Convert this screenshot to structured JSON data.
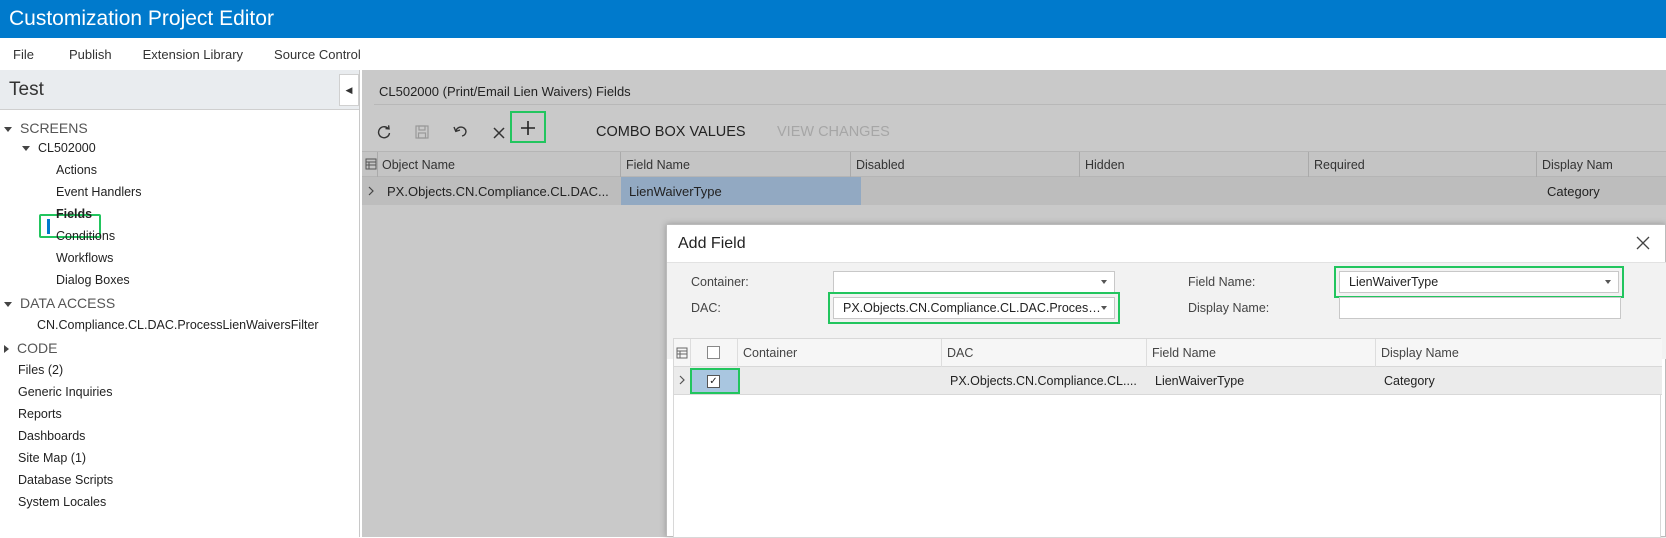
{
  "app": {
    "title": "Customization Project Editor"
  },
  "menu": {
    "items": [
      "File",
      "Publish",
      "Extension Library",
      "Source Control"
    ]
  },
  "project": {
    "name": "Test"
  },
  "tree": {
    "screens_label": "SCREENS",
    "screen_id": "CL502000",
    "screen_children": [
      "Actions",
      "Event Handlers",
      "Fields",
      "Conditions",
      "Workflows",
      "Dialog Boxes"
    ],
    "data_access_label": "DATA ACCESS",
    "data_access_item": "CN.Compliance.CL.DAC.ProcessLienWaiversFilter",
    "code_label": "CODE",
    "other_items": [
      "Files (2)",
      "Generic Inquiries",
      "Reports",
      "Dashboards",
      "Site Map (1)",
      "Database Scripts",
      "System Locales"
    ]
  },
  "main": {
    "title": "CL502000 (Print/Email Lien Waivers) Fields",
    "toolbar": {
      "combo_box_values": "COMBO BOX VALUES",
      "view_changes": "VIEW CHANGES"
    },
    "grid": {
      "columns": [
        "Object Name",
        "Field Name",
        "Disabled",
        "Hidden",
        "Required",
        "Display Nam"
      ],
      "row": {
        "object_name": "PX.Objects.CN.Compliance.CL.DAC...",
        "field_name": "LienWaiverType",
        "display_name": "Category"
      }
    }
  },
  "dialog": {
    "title": "Add Field",
    "container_label": "Container:",
    "container_value": "",
    "dac_label": "DAC:",
    "dac_value": "PX.Objects.CN.Compliance.CL.DAC.Proces…",
    "field_name_label": "Field Name:",
    "field_name_value": "LienWaiverType",
    "display_name_label": "Display Name:",
    "display_name_value": "",
    "grid": {
      "columns": [
        "Container",
        "DAC",
        "Field Name",
        "Display Name"
      ],
      "row": {
        "container": "",
        "dac": "PX.Objects.CN.Compliance.CL....",
        "field_name": "LienWaiverType",
        "display_name": "Category",
        "selected": true
      }
    }
  },
  "colors": {
    "accent": "#007acc",
    "highlight": "#22c55e"
  }
}
